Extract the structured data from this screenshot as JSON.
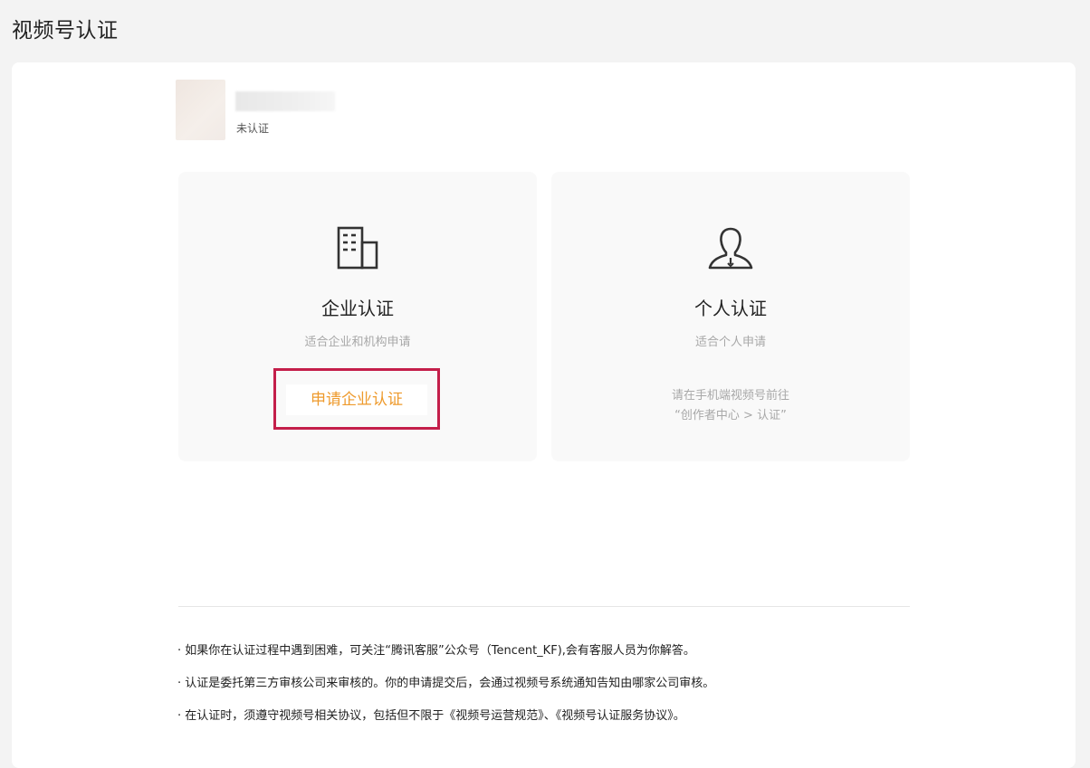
{
  "header": {
    "title": "视频号认证"
  },
  "account": {
    "status": "未认证"
  },
  "cards": {
    "enterprise": {
      "icon": "building-icon",
      "title": "企业认证",
      "subtitle": "适合企业和机构申请",
      "button_label": "申请企业认证"
    },
    "personal": {
      "icon": "person-icon",
      "title": "个人认证",
      "subtitle": "适合个人申请",
      "note_line1": "请在手机端视频号前往",
      "note_line2": "“创作者中心 > 认证”"
    }
  },
  "notes": [
    "· 如果你在认证过程中遇到困难，可关注“腾讯客服”公众号（Tencent_KF),会有客服人员为你解答。",
    "· 认证是委托第三方审核公司来审核的。你的申请提交后，会通过视频号系统通知告知由哪家公司审核。",
    "· 在认证时，须遵守视频号相关协议，包括但不限于《视频号运营规范》、《视频号认证服务协议》。"
  ],
  "colors": {
    "accent": "#ee9a2c",
    "highlight_frame": "#c41e4a",
    "muted_text": "#a8a8a8"
  }
}
